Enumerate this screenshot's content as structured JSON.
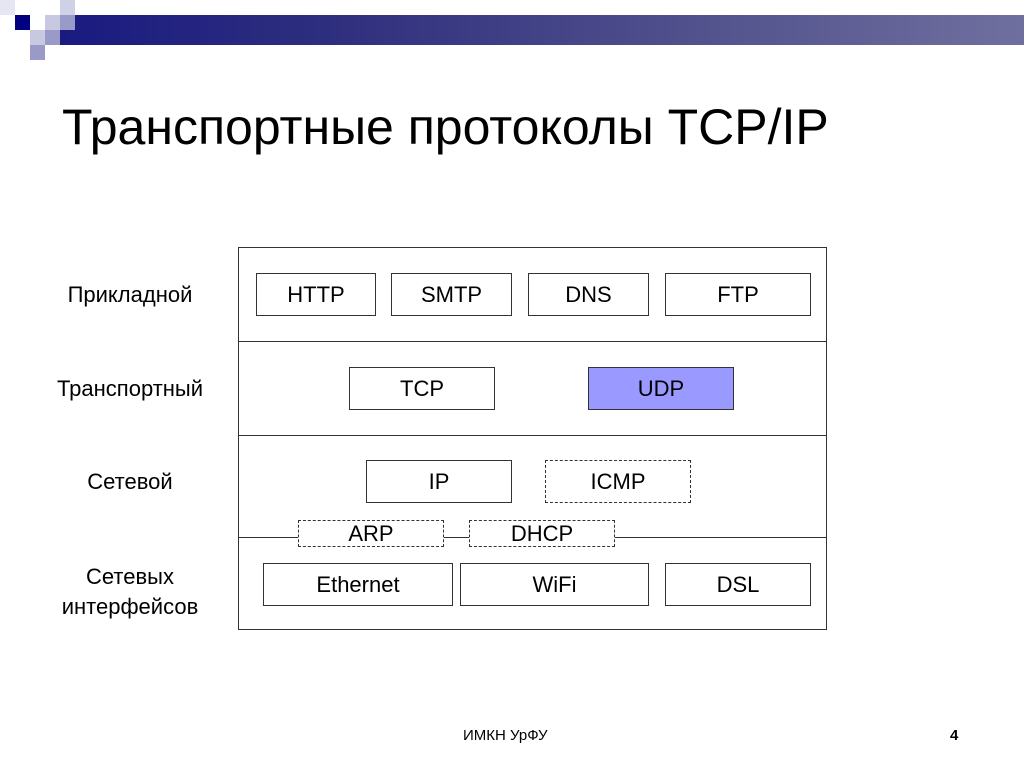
{
  "slide": {
    "title": "Транспортные протоколы TCP/IP",
    "footer_text": "ИМКН УрФУ",
    "page_number": "4"
  },
  "layers": [
    {
      "label": "Прикладной",
      "protocols": [
        "HTTP",
        "SMTP",
        "DNS",
        "FTP"
      ]
    },
    {
      "label": "Транспортный",
      "protocols": [
        "TCP",
        "UDP"
      ]
    },
    {
      "label": "Сетевой",
      "protocols": [
        "IP",
        "ICMP"
      ]
    },
    {
      "label_line1": "Сетевых",
      "label_line2": "интерфейсов",
      "protocols": [
        "Ethernet",
        "WiFi",
        "DSL"
      ]
    }
  ],
  "boundary_protocols": [
    "ARP",
    "DHCP"
  ],
  "colors": {
    "highlight": "#9999ff",
    "header_bar": "#1a1a80"
  }
}
